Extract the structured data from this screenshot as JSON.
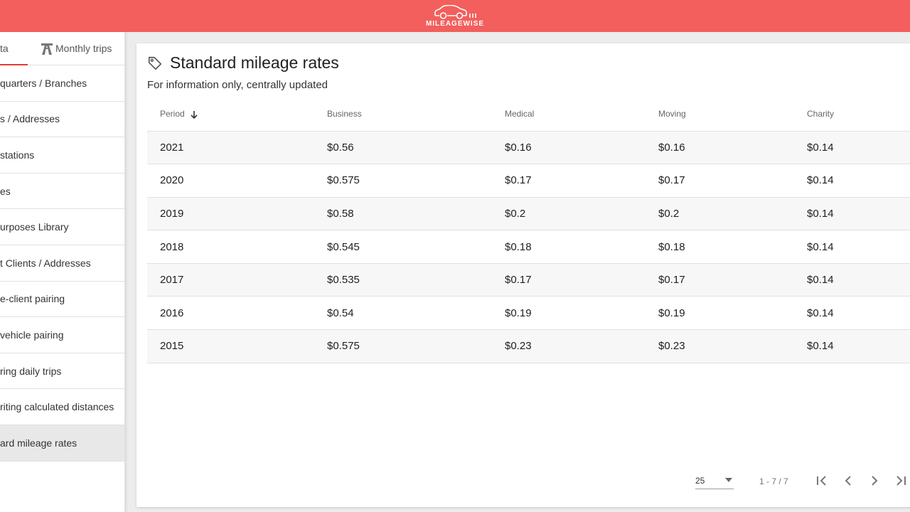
{
  "app": {
    "logo_text": "MILEAGEWISE",
    "brand_color": "#f25f5c"
  },
  "sidebar": {
    "tabs": [
      {
        "label": "ta",
        "active": true
      },
      {
        "label": "Monthly trips",
        "icon": "road-icon",
        "active": false
      }
    ],
    "items": [
      {
        "label": "quarters / Branches"
      },
      {
        "label": "s / Addresses"
      },
      {
        "label": " stations"
      },
      {
        "label": "es"
      },
      {
        "label": "urposes Library"
      },
      {
        "label": "t Clients / Addresses"
      },
      {
        "label": "e-client pairing"
      },
      {
        "label": "vehicle pairing"
      },
      {
        "label": "ring daily trips"
      },
      {
        "label": "riting calculated distances"
      },
      {
        "label": "ard mileage rates",
        "active": true
      }
    ]
  },
  "main": {
    "title": "Standard mileage rates",
    "title_icon": "tag-icon",
    "subtitle": "For information only, centrally updated",
    "table": {
      "columns": [
        "Period",
        "Business",
        "Medical",
        "Moving",
        "Charity"
      ],
      "sort_column": "Period",
      "sort_direction": "descending",
      "rows": [
        [
          "2021",
          "$0.56",
          "$0.16",
          "$0.16",
          "$0.14"
        ],
        [
          "2020",
          "$0.575",
          "$0.17",
          "$0.17",
          "$0.14"
        ],
        [
          "2019",
          "$0.58",
          "$0.2",
          "$0.2",
          "$0.14"
        ],
        [
          "2018",
          "$0.545",
          "$0.18",
          "$0.18",
          "$0.14"
        ],
        [
          "2017",
          "$0.535",
          "$0.17",
          "$0.17",
          "$0.14"
        ],
        [
          "2016",
          "$0.54",
          "$0.19",
          "$0.19",
          "$0.14"
        ],
        [
          "2015",
          "$0.575",
          "$0.23",
          "$0.23",
          "$0.14"
        ]
      ]
    },
    "pagination": {
      "per_page": "25",
      "range": "1 - 7 / 7"
    }
  }
}
